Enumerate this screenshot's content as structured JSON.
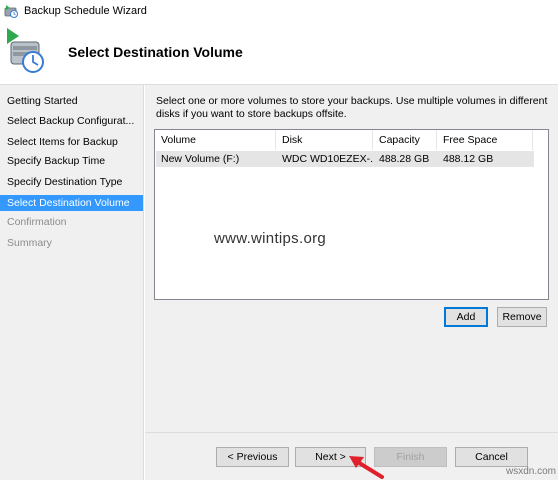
{
  "window": {
    "title": "Backup Schedule Wizard",
    "heading": "Select Destination Volume"
  },
  "sidebar": {
    "items": [
      {
        "label": "Getting Started",
        "state": "normal"
      },
      {
        "label": "Select Backup Configurat...",
        "state": "normal"
      },
      {
        "label": "Select Items for Backup",
        "state": "normal"
      },
      {
        "label": "Specify Backup Time",
        "state": "normal"
      },
      {
        "label": "Specify Destination Type",
        "state": "normal"
      },
      {
        "label": "Select Destination Volume",
        "state": "active"
      },
      {
        "label": "Confirmation",
        "state": "disabled"
      },
      {
        "label": "Summary",
        "state": "disabled"
      }
    ]
  },
  "main": {
    "instructions": "Select one or more volumes to store your backups. Use multiple volumes in different disks if you want to store backups offsite.",
    "table": {
      "columns": [
        "Volume",
        "Disk",
        "Capacity",
        "Free Space"
      ],
      "rows": [
        [
          "New Volume (F:)",
          "WDC WD10EZEX-...",
          "488.28 GB",
          "488.12 GB"
        ]
      ]
    },
    "add_label": "Add",
    "remove_label": "Remove"
  },
  "footer": {
    "previous_label": "< Previous",
    "next_label": "Next >",
    "finish_label": "Finish",
    "cancel_label": "Cancel"
  },
  "watermark": "www.wintips.org",
  "site_tag": "wsxdn.com",
  "colors": {
    "selection": "#3399ff",
    "panel": "#f0f0f0",
    "arrow": "#e0202a",
    "default_button_border": "#0078d7"
  },
  "icons": [
    "backup-app-icon",
    "backup-wizard-icon",
    "red-arrow-icon"
  ]
}
